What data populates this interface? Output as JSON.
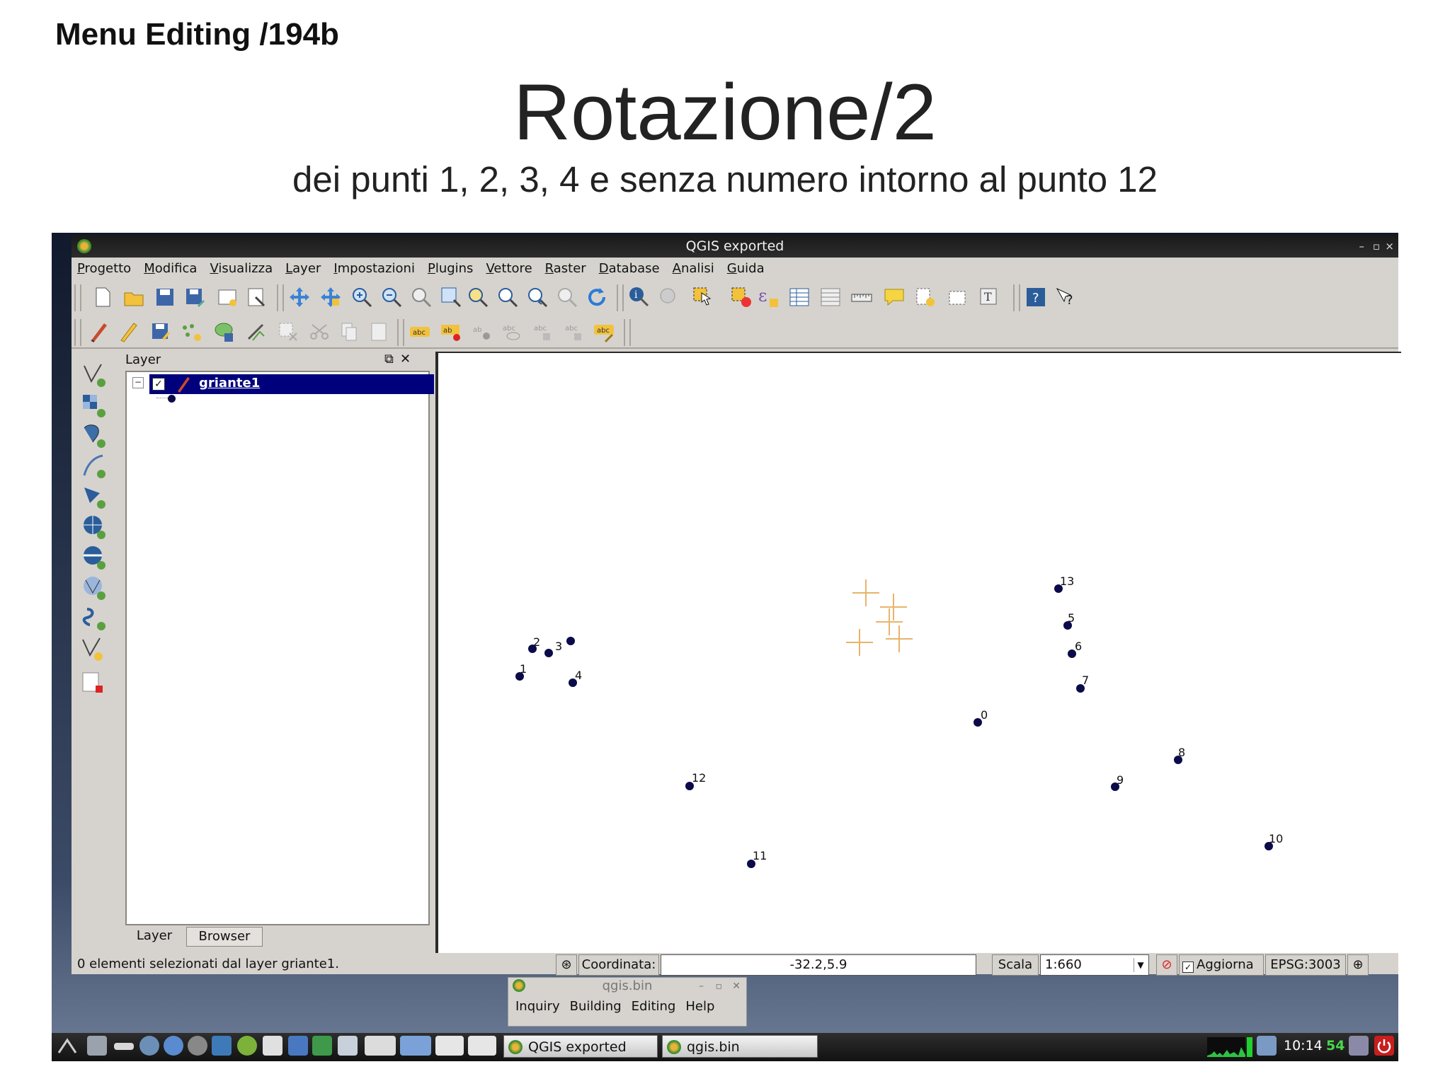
{
  "slide": {
    "label": "Menu Editing /194b",
    "title": "Rotazione/2",
    "subtitle": "dei punti 1, 2, 3, 4 e senza numero intorno al punto 12"
  },
  "window": {
    "title": "QGIS exported",
    "controls": [
      "–",
      "▫",
      "×"
    ]
  },
  "menu": [
    "Progetto",
    "Modifica",
    "Visualizza",
    "Layer",
    "Impostazioni",
    "Plugins",
    "Vettore",
    "Raster",
    "Database",
    "Analisi",
    "Guida"
  ],
  "layer_panel": {
    "title": "Layer",
    "layer_name": "griante1",
    "tabs": [
      "Layer",
      "Browser"
    ]
  },
  "map": {
    "point_labels": [
      "1",
      "2",
      "3",
      "4",
      "0",
      "5",
      "6",
      "7",
      "8",
      "9",
      "10",
      "11",
      "12",
      "13"
    ],
    "colors": {
      "point": "#0b0b4a",
      "cross": "#e8b46a"
    }
  },
  "status": {
    "message": "0 elementi selezionati dal layer griante1.",
    "coord_label": "Coordinata:",
    "coord_value": "-32.2,5.9",
    "scale_label": "Scala",
    "scale_value": "1:660",
    "refresh_label": "Aggiorna",
    "epsg": "EPSG:3003"
  },
  "popup": {
    "title": "qgis.bin",
    "menu": [
      "Inquiry",
      "Building",
      "Editing",
      "Help"
    ]
  },
  "taskbar": {
    "tasks": [
      "QGIS exported",
      "qgis.bin"
    ],
    "clock": "10:14",
    "clock_seconds": "54"
  }
}
